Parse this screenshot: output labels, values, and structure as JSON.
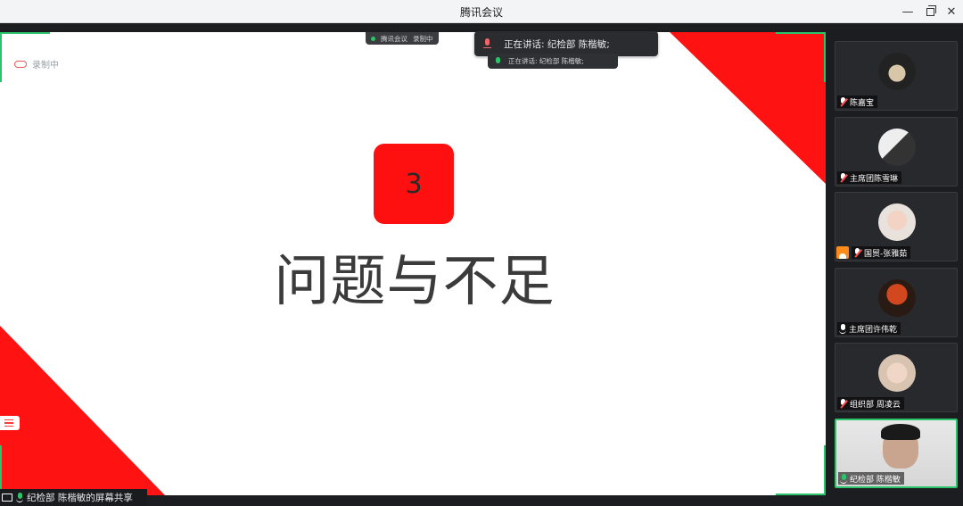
{
  "window": {
    "title": "腾讯会议"
  },
  "slide": {
    "number": "3",
    "heading": "问题与不足",
    "recording_label": "录制中",
    "mini_bar": {
      "app": "腾讯会议",
      "recording": "录制中"
    }
  },
  "speaking": {
    "text": "正在讲话: 纪检部 陈楷敏;",
    "sub_text": "正在讲话: 纪检部 陈楷敏;"
  },
  "participants": [
    {
      "name": "陈嘉宝",
      "mic": "muted"
    },
    {
      "name": "主席团陈雪琳",
      "mic": "muted"
    },
    {
      "name": "国贸-张雅茹",
      "mic": "muted",
      "host_badge": true
    },
    {
      "name": "主席团许伟乾",
      "mic": "on"
    },
    {
      "name": "组织部 周凌云",
      "mic": "muted"
    },
    {
      "name": "纪检部 陈楷敏",
      "mic": "on",
      "active": true
    }
  ],
  "bottom_bar": {
    "share_label": "纪检部 陈楷敏的屏幕共享"
  },
  "colors": {
    "accent_green": "#2dc36b",
    "slide_red": "#ff1212"
  }
}
